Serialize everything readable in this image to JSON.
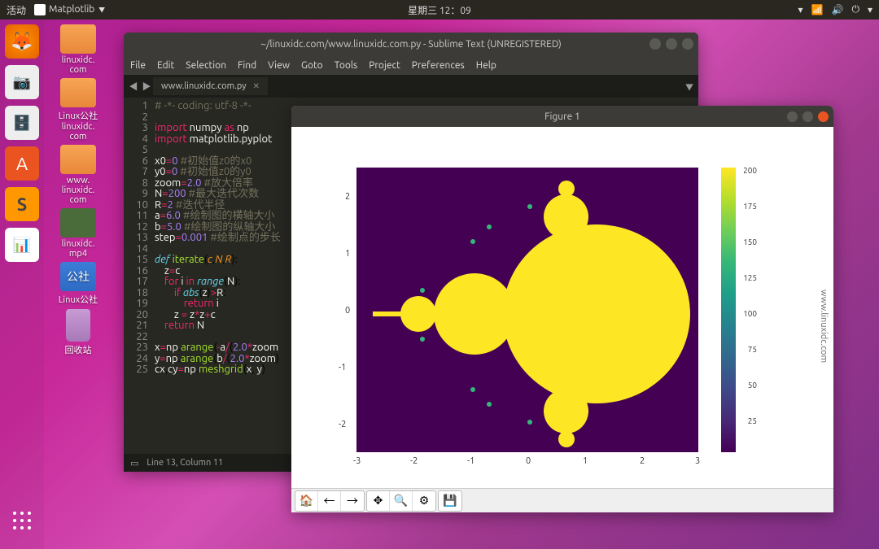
{
  "topbar": {
    "activities": "活动",
    "app_indicator": "Matplotlib",
    "clock": "星期三 12：09"
  },
  "desktop_icons": [
    {
      "label": "linuxidc.\ncom"
    },
    {
      "label": "Linux公社\nlinuxidc.\ncom"
    },
    {
      "label": "www.\nlinuxidc.\ncom"
    },
    {
      "label": "linuxidc.\nmp4"
    },
    {
      "label": "Linux公社"
    },
    {
      "label": "回收站"
    }
  ],
  "sublime": {
    "title": "~/linuxidc.com/www.linuxidc.com.py - Sublime Text (UNREGISTERED)",
    "menu": [
      "File",
      "Edit",
      "Selection",
      "Find",
      "View",
      "Goto",
      "Tools",
      "Project",
      "Preferences",
      "Help"
    ],
    "tab": "www.linuxidc.com.py",
    "status": "Line 13, Column 11",
    "code_lines": [
      {
        "n": 1,
        "html": "<span class='c'># -*- coding: utf-8 -*-</span>"
      },
      {
        "n": 2,
        "html": ""
      },
      {
        "n": 3,
        "html": "<span class='k'>import</span> <span class='v'>numpy</span> <span class='k'>as</span> <span class='v'>np</span>"
      },
      {
        "n": 4,
        "html": "<span class='k'>import</span> <span class='v'>matplotlib.pyplot</span>"
      },
      {
        "n": 5,
        "html": ""
      },
      {
        "n": 6,
        "html": "<span class='v'>x0</span><span class='o'>=</span><span class='n'>0</span> <span class='c'>#初始值z0的x0</span>"
      },
      {
        "n": 7,
        "html": "<span class='v'>y0</span><span class='o'>=</span><span class='n'>0</span> <span class='c'>#初始值z0的y0</span>"
      },
      {
        "n": 8,
        "html": "<span class='v'>zoom</span><span class='o'>=</span><span class='n'>2.0</span> <span class='c'>#放大倍率</span>"
      },
      {
        "n": 9,
        "html": "<span class='v'>N</span><span class='o'>=</span><span class='n'>200</span> <span class='c'>#最大迭代次数</span>"
      },
      {
        "n": 10,
        "html": "<span class='v'>R</span><span class='o'>=</span><span class='n'>2</span> <span class='c'>#迭代半径</span>"
      },
      {
        "n": 11,
        "html": "<span class='v'>a</span><span class='o'>=</span><span class='n'>6.0</span> <span class='c'>#绘制图的横轴大小</span>"
      },
      {
        "n": 12,
        "html": "<span class='v'>b</span><span class='o'>=</span><span class='n'>5.0</span> <span class='c'>#绘制图的纵轴大小</span>"
      },
      {
        "n": 13,
        "html": "<span class='v'>step</span><span class='o'>=</span><span class='n'>0.001</span> <span class='c'>#绘制点的步长</span>"
      },
      {
        "n": 14,
        "html": ""
      },
      {
        "n": 15,
        "html": "<span class='b'>def</span> <span class='f'>iterate</span>(<span class='p'>c</span>,<span class='p'>N</span>,<span class='p'>R</span>):"
      },
      {
        "n": 16,
        "html": "    <span class='v'>z</span><span class='o'>=</span><span class='v'>c</span>"
      },
      {
        "n": 17,
        "html": "    <span class='k'>for</span> <span class='v'>i</span> <span class='k'>in</span> <span class='b'>range</span>(<span class='v'>N</span>):"
      },
      {
        "n": 18,
        "html": "        <span class='k'>if</span> <span class='b'>abs</span>(<span class='v'>z</span>)<span class='o'>></span><span class='v'>R</span>:"
      },
      {
        "n": 19,
        "html": "            <span class='k'>return</span> <span class='v'>i</span>"
      },
      {
        "n": 20,
        "html": "        <span class='v'>z</span> <span class='o'>=</span> <span class='v'>z</span><span class='o'>*</span><span class='v'>z</span><span class='o'>+</span><span class='v'>c</span>"
      },
      {
        "n": 21,
        "html": "    <span class='k'>return</span> <span class='v'>N</span>"
      },
      {
        "n": 22,
        "html": ""
      },
      {
        "n": 23,
        "html": "<span class='v'>x</span><span class='o'>=</span><span class='v'>np</span>.<span class='f'>arange</span>(<span class='o'>-</span><span class='v'>a</span><span class='o'>/</span>(<span class='n'>2.0</span><span class='o'>*</span><span class='v'>zoom</span>"
      },
      {
        "n": 24,
        "html": "<span class='v'>y</span><span class='o'>=</span><span class='v'>np</span>.<span class='f'>arange</span>(<span class='v'>b</span><span class='o'>/</span>(<span class='n'>2.0</span><span class='o'>*</span><span class='v'>zoom</span>)"
      },
      {
        "n": 25,
        "html": "<span class='v'>cx</span>,<span class='v'>cy</span><span class='o'>=</span><span class='v'>np</span>.<span class='f'>meshgrid</span>(<span class='v'>x</span>, <span class='v'>y</span>)"
      }
    ]
  },
  "figure": {
    "title": "Figure 1",
    "watermark": "www.linuxidc.com",
    "x_ticks": [
      "-3",
      "-2",
      "-1",
      "0",
      "1",
      "2",
      "3"
    ],
    "y_ticks": [
      "-2",
      "-1",
      "0",
      "1",
      "2"
    ],
    "cb_ticks": [
      "200",
      "175",
      "150",
      "125",
      "100",
      "75",
      "50",
      "25"
    ]
  },
  "chart_data": {
    "type": "heatmap",
    "title": "",
    "xlabel": "",
    "ylabel": "",
    "xlim": [
      -3,
      3
    ],
    "ylim": [
      -2.5,
      2.5
    ],
    "colorbar": {
      "min": 0,
      "max": 200,
      "cmap": "viridis"
    },
    "description": "Mandelbrot set iteration count; interior=200 (yellow), exterior gradient to 0 (dark purple)",
    "parameters": {
      "x0": 0,
      "y0": 0,
      "zoom": 2.0,
      "N": 200,
      "R": 2,
      "a": 6.0,
      "b": 5.0,
      "step": 0.001
    }
  }
}
